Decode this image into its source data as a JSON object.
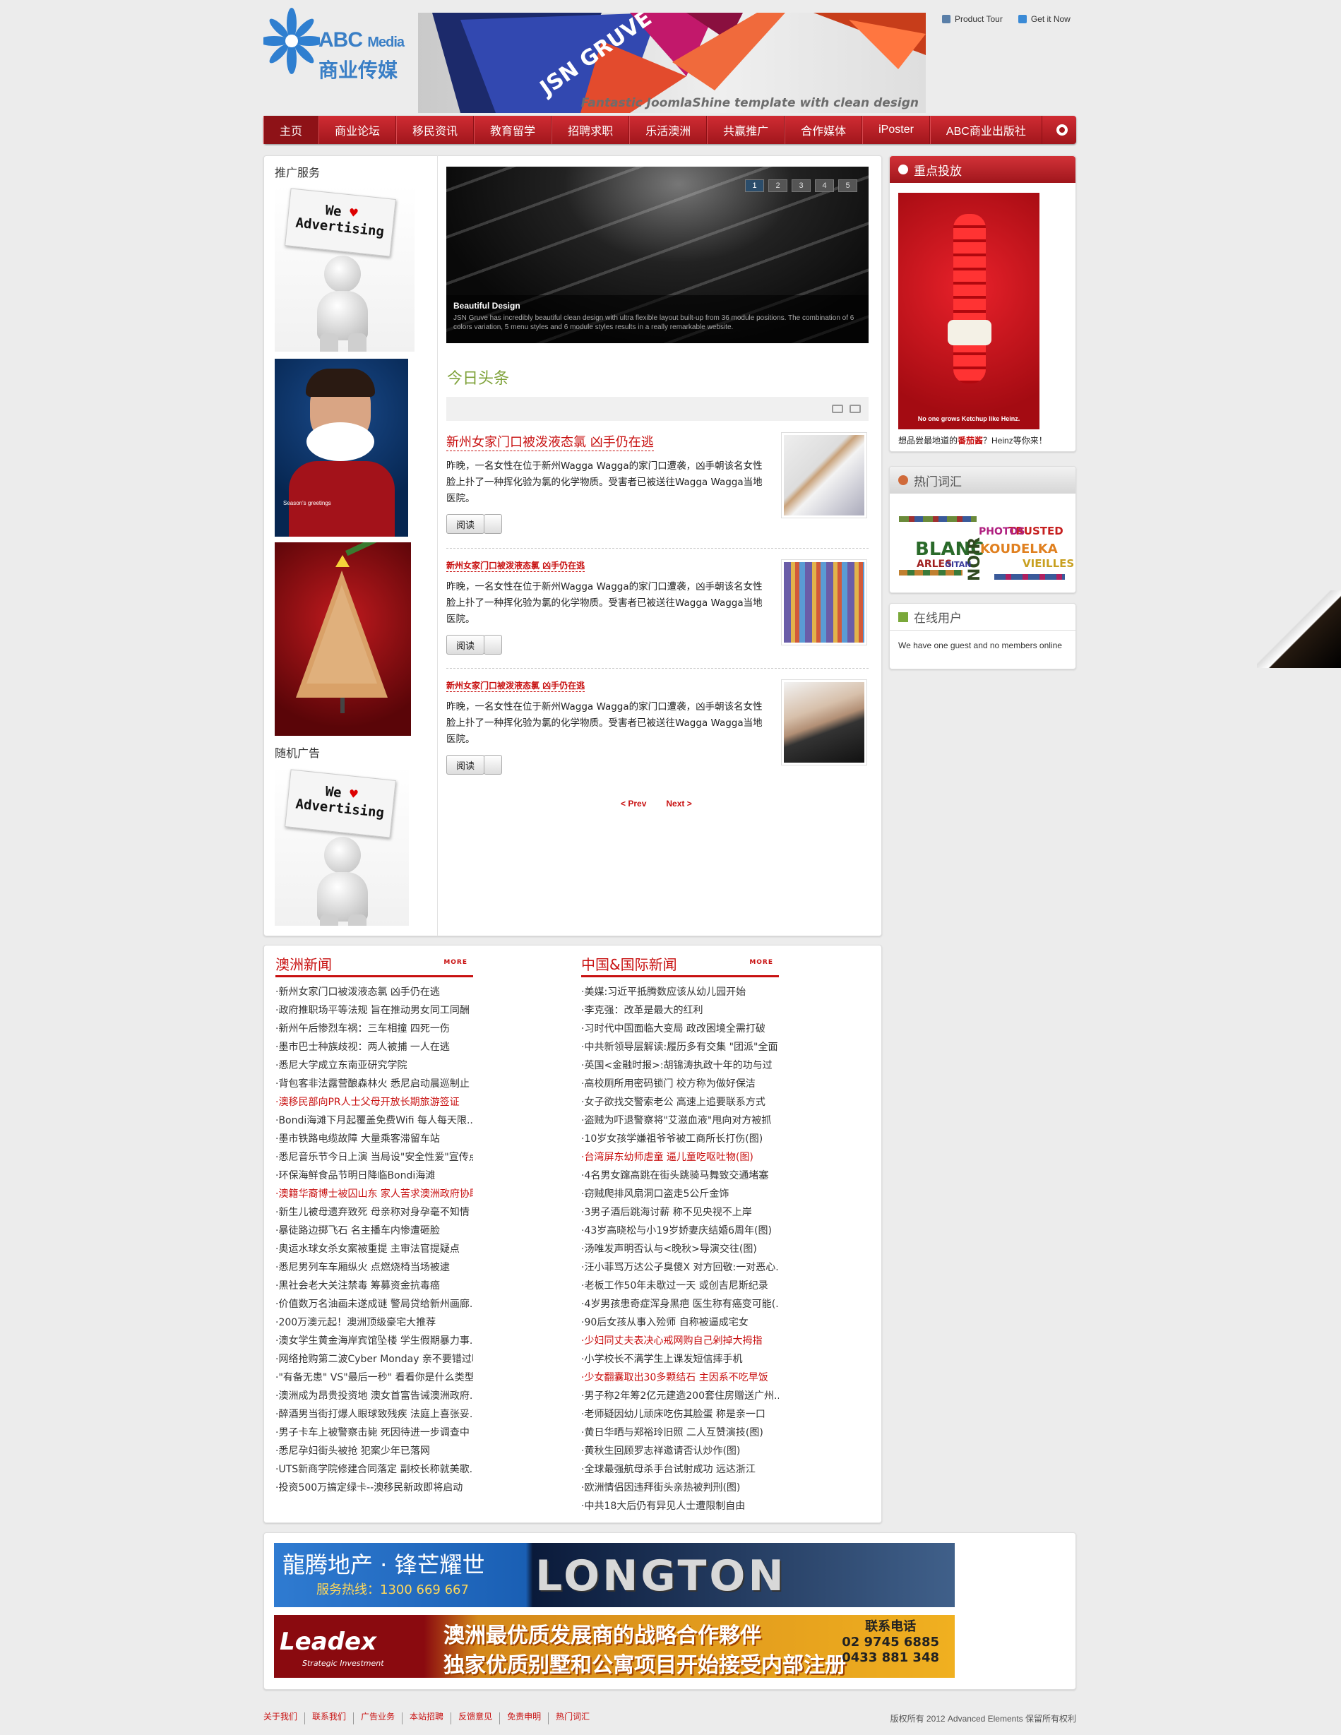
{
  "header": {
    "logo_en": "ABC",
    "logo_en_small": "Media",
    "logo_cn": "商业传媒",
    "banner_title": "JSN GRUVE",
    "banner_sub": "Fantastic JoomlaShine template with clean design",
    "toplinks": [
      "Product Tour",
      "Get it Now"
    ]
  },
  "nav": {
    "items": [
      "主页",
      "商业论坛",
      "移民资讯",
      "教育留学",
      "招聘求职",
      "乐活澳洲",
      "共赢推广",
      "合作媒体",
      "iPoster",
      "ABC商业出版社"
    ],
    "active": 0
  },
  "left": {
    "promo_title": "推广服务",
    "random_title": "随机广告",
    "ad_card_line1": "We",
    "ad_card_line2": "Advertising",
    "heart": "♥",
    "ad2_caption": "Season's greetings"
  },
  "slideshow": {
    "pages": [
      "1",
      "2",
      "3",
      "4",
      "5"
    ],
    "active": 0,
    "caption_title": "Beautiful Design",
    "caption_text": "JSN Gruve has incredibly beautiful clean design with ultra flexible layout built-up from 36 module positions. The combination of 6 colors variation, 5 menu styles and 6 module styles results in a really remarkable website."
  },
  "today": {
    "title": "今日头条",
    "articles": [
      {
        "title": "新州女家门口被泼液态氯 凶手仍在逃",
        "text": "昨晚，一名女性在位于新州Wagga Wagga的家门口遭袭，凶手朝该名女性脸上扑了一种挥化验为氯的化学物质。受害者已被送往Wagga Wagga当地医院。",
        "btn": "阅读"
      },
      {
        "title": "新州女家门口被泼液态氯 凶手仍在逃",
        "text": "昨晚，一名女性在位于新州Wagga Wagga的家门口遭袭，凶手朝该名女性脸上扑了一种挥化验为氯的化学物质。受害者已被送往Wagga Wagga当地医院。",
        "btn": "阅读"
      },
      {
        "title": "新州女家门口被泼液态氯 凶手仍在逃",
        "text": "昨晚，一名女性在位于新州Wagga Wagga的家门口遭袭，凶手朝该名女性脸上扑了一种挥化验为氯的化学物质。受害者已被送往Wagga Wagga当地医院。",
        "btn": "阅读"
      }
    ],
    "prev": "< Prev",
    "next": "Next >"
  },
  "right": {
    "featured_title": "重点投放",
    "featured_ad_tag": "No one grows Ketchup like Heinz.",
    "featured_caption_pre": "想品尝最地道的",
    "featured_caption_hl": "番茄酱",
    "featured_caption_post": "？Heinz等你来！",
    "tags_title": "热门词汇",
    "tag_words": [
      "PHOTOS",
      "TRUSTED",
      "BLANC",
      "KOUDELKA",
      "NOIR",
      "VIEILLES",
      "ARLES",
      "GITAN"
    ],
    "online_title": "在线用户",
    "online_text": "We have one guest and no members online"
  },
  "news": {
    "more": "MORE",
    "col1": {
      "title": "澳洲新闻",
      "items": [
        {
          "t": "·新州女家门口被泼液态氯 凶手仍在逃",
          "hot": false
        },
        {
          "t": "·政府推职场平等法规 旨在推动男女同工同酬",
          "hot": false
        },
        {
          "t": "·新州午后惨烈车祸：三车相撞 四死一伤",
          "hot": false
        },
        {
          "t": "·墨市巴士种族歧视：两人被捕 一人在逃",
          "hot": false
        },
        {
          "t": "·悉尼大学成立东南亚研究学院",
          "hot": false
        },
        {
          "t": "·背包客非法露营酿森林火 悉尼启动晨巡制止",
          "hot": false
        },
        {
          "t": "·澳移民部向PR人士父母开放长期旅游签证",
          "hot": true
        },
        {
          "t": "·Bondi海滩下月起覆盖免费Wifi 每人每天限...",
          "hot": false
        },
        {
          "t": "·墨市铁路电缆故障 大量乘客滞留车站",
          "hot": false
        },
        {
          "t": "·悉尼音乐节今日上演 当局设\"安全性爱\"宣传点",
          "hot": false
        },
        {
          "t": "·环保海鲜食品节明日降临Bondi海滩",
          "hot": false
        },
        {
          "t": "·澳籍华裔博士被囚山东 家人苦求澳洲政府协助",
          "hot": true
        },
        {
          "t": "·新生儿被母遗弃致死 母亲称对身孕毫不知情",
          "hot": false
        },
        {
          "t": "·暴徒路边掷飞石 名主播车内惨遭砸脸",
          "hot": false
        },
        {
          "t": "·奥运水球女杀女案被重提 主审法官提疑点",
          "hot": false
        },
        {
          "t": "·悉尼男列车车厢纵火 点燃烧椅当场被逮",
          "hot": false
        },
        {
          "t": "·黑社会老大关注禁毒 筹募资金抗毒癌",
          "hot": false
        },
        {
          "t": "·价值数万名油画未遂成谜 警局贷给新州画廊...",
          "hot": false
        },
        {
          "t": "·200万澳元起！澳洲顶级豪宅大推荐",
          "hot": false
        },
        {
          "t": "·澳女学生黄金海岸宾馆坠楼 学生假期暴力事...",
          "hot": false
        },
        {
          "t": "·网络抢购第二波Cyber Monday 亲不要错过哟",
          "hot": false
        },
        {
          "t": "·\"有备无患\" VS\"最后一秒\" 看看你是什么类型...",
          "hot": false
        },
        {
          "t": "·澳洲成为昂贵投资地 澳女首富告诫澳洲政府...",
          "hot": false
        },
        {
          "t": "·醉酒男当街打爆人眼球致残疾 法庭上喜张妥...",
          "hot": false
        },
        {
          "t": "·男子卡车上被警察击毙 死因待进一步调查中",
          "hot": false
        },
        {
          "t": "·悉尼孕妇街头被抢 犯案少年已落网",
          "hot": false
        },
        {
          "t": "·UTS新商学院修建合同落定 副校长称就美歌...",
          "hot": false
        },
        {
          "t": "·投资500万搞定绿卡--澳移民新政即将启动",
          "hot": false
        }
      ]
    },
    "col2": {
      "title": "中国&国际新闻",
      "items": [
        {
          "t": "·美媒:习近平抵腾数应该从幼儿园开始",
          "hot": false
        },
        {
          "t": "·李克强：改革是最大的红利",
          "hot": false
        },
        {
          "t": "·习时代中国面临大变局 政改困境全需打破",
          "hot": false
        },
        {
          "t": "·中共新领导层解读:履历多有交集 \"团派\"全面...",
          "hot": false
        },
        {
          "t": "·英国<金融时报>:胡锦涛执政十年的功与过",
          "hot": false
        },
        {
          "t": "·高校厕所用密码锁门 校方称为做好保洁",
          "hot": false
        },
        {
          "t": "·女子欲找交警索老公 高速上追要联系方式",
          "hot": false
        },
        {
          "t": "·盗贼为吓退警察将\"艾滋血液\"甩向对方被抓",
          "hot": false
        },
        {
          "t": "·10岁女孩学嫌祖爷爷被工商所长打伤(图)",
          "hot": false
        },
        {
          "t": "·台湾屏东幼师虐童 逼儿童吃呕吐物(图)",
          "hot": true
        },
        {
          "t": "·4名男女蹿高跳在街头跳骑马舞致交通堵塞",
          "hot": false
        },
        {
          "t": "·窃贼爬排风扇洞口盗走5公斤金饰",
          "hot": false
        },
        {
          "t": "·3男子酒后跳海讨薪 称不见央视不上岸",
          "hot": false
        },
        {
          "t": "·43岁高晓松与小19岁娇妻庆结婚6周年(图)",
          "hot": false
        },
        {
          "t": "·汤唯发声明否认与<晚秋>导演交往(图)",
          "hot": false
        },
        {
          "t": "·汪小菲骂万达公子臭傻X 对方回敬:一对恶心...",
          "hot": false
        },
        {
          "t": "·老板工作50年未歇过一天 或创吉尼斯纪录",
          "hot": false
        },
        {
          "t": "·4岁男孩患奇症浑身黑疤 医生称有癌变可能(...",
          "hot": false
        },
        {
          "t": "·90后女孩从事入殓师 自称被逼成宅女",
          "hot": false
        },
        {
          "t": "·少妇同丈夫表决心戒网购自己剁掉大拇指",
          "hot": true
        },
        {
          "t": "·小学校长不满学生上课发短信摔手机",
          "hot": false
        },
        {
          "t": "·少女翻囊取出30多颗结石 主因系不吃早饭",
          "hot": true
        },
        {
          "t": "·男子称2年筹2亿元建造200套住房赠送广州...",
          "hot": false
        },
        {
          "t": "·老师疑因幼儿顽床吃伤其脸蛋 称是亲一口",
          "hot": false
        },
        {
          "t": "·黄日华晒与郑裕玲旧照 二人互赞演技(图)",
          "hot": false
        },
        {
          "t": "·黄秋生回顾罗志祥邀请否认炒作(图)",
          "hot": false
        },
        {
          "t": "·全球最强航母杀手台试射成功 远达浙江",
          "hot": false
        },
        {
          "t": "·欧洲情侣因违拜街头亲热被判刑(图)",
          "hot": false
        },
        {
          "t": "·中共18大后仍有异见人士遭限制自由",
          "hot": false
        }
      ]
    }
  },
  "ads": {
    "ad1_title": "龍腾地产 · 锋芒耀世",
    "ad1_phone": "服务热线：1300 669 667",
    "ad1_brand": "LONGTON",
    "ad2_logo": "Leadex",
    "ad2_logo_sub": "Strategic Investment",
    "ad2_line1": "澳洲最优质发展商的战略合作夥伴",
    "ad2_line2": "独家优质别墅和公寓项目开始接受内部注册",
    "ad2_phone_title": "联系电话",
    "ad2_phone1": "02 9745 6885",
    "ad2_phone2": "0433 881 348"
  },
  "footer": {
    "links": [
      "关于我们",
      "联系我们",
      "广告业务",
      "本站招聘",
      "反馈意见",
      "免责申明",
      "热门词汇"
    ],
    "copyright": "版权所有 2012 Advanced Elements 保留所有权利"
  }
}
